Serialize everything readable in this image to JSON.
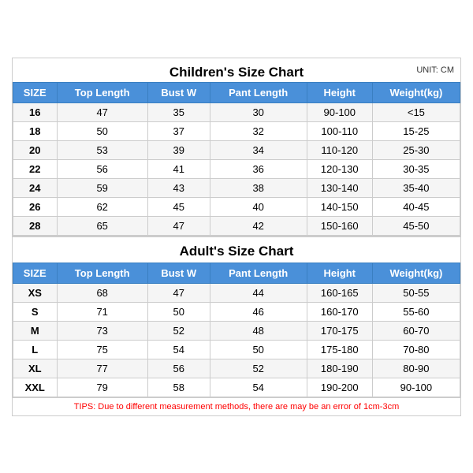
{
  "children_title": "Children's Size Chart",
  "unit": "UNIT: CM",
  "children_headers": [
    "SIZE",
    "Top Length",
    "Bust W",
    "Pant Length",
    "Height",
    "Weight(kg)"
  ],
  "children_rows": [
    [
      "16",
      "47",
      "35",
      "30",
      "90-100",
      "<15"
    ],
    [
      "18",
      "50",
      "37",
      "32",
      "100-110",
      "15-25"
    ],
    [
      "20",
      "53",
      "39",
      "34",
      "110-120",
      "25-30"
    ],
    [
      "22",
      "56",
      "41",
      "36",
      "120-130",
      "30-35"
    ],
    [
      "24",
      "59",
      "43",
      "38",
      "130-140",
      "35-40"
    ],
    [
      "26",
      "62",
      "45",
      "40",
      "140-150",
      "40-45"
    ],
    [
      "28",
      "65",
      "47",
      "42",
      "150-160",
      "45-50"
    ]
  ],
  "adult_title": "Adult's Size Chart",
  "adult_headers": [
    "SIZE",
    "Top Length",
    "Bust W",
    "Pant Length",
    "Height",
    "Weight(kg)"
  ],
  "adult_rows": [
    [
      "XS",
      "68",
      "47",
      "44",
      "160-165",
      "50-55"
    ],
    [
      "S",
      "71",
      "50",
      "46",
      "160-170",
      "55-60"
    ],
    [
      "M",
      "73",
      "52",
      "48",
      "170-175",
      "60-70"
    ],
    [
      "L",
      "75",
      "54",
      "50",
      "175-180",
      "70-80"
    ],
    [
      "XL",
      "77",
      "56",
      "52",
      "180-190",
      "80-90"
    ],
    [
      "XXL",
      "79",
      "58",
      "54",
      "190-200",
      "90-100"
    ]
  ],
  "tips": "TIPS: Due to different measurement methods, there are may be an error of 1cm-3cm"
}
